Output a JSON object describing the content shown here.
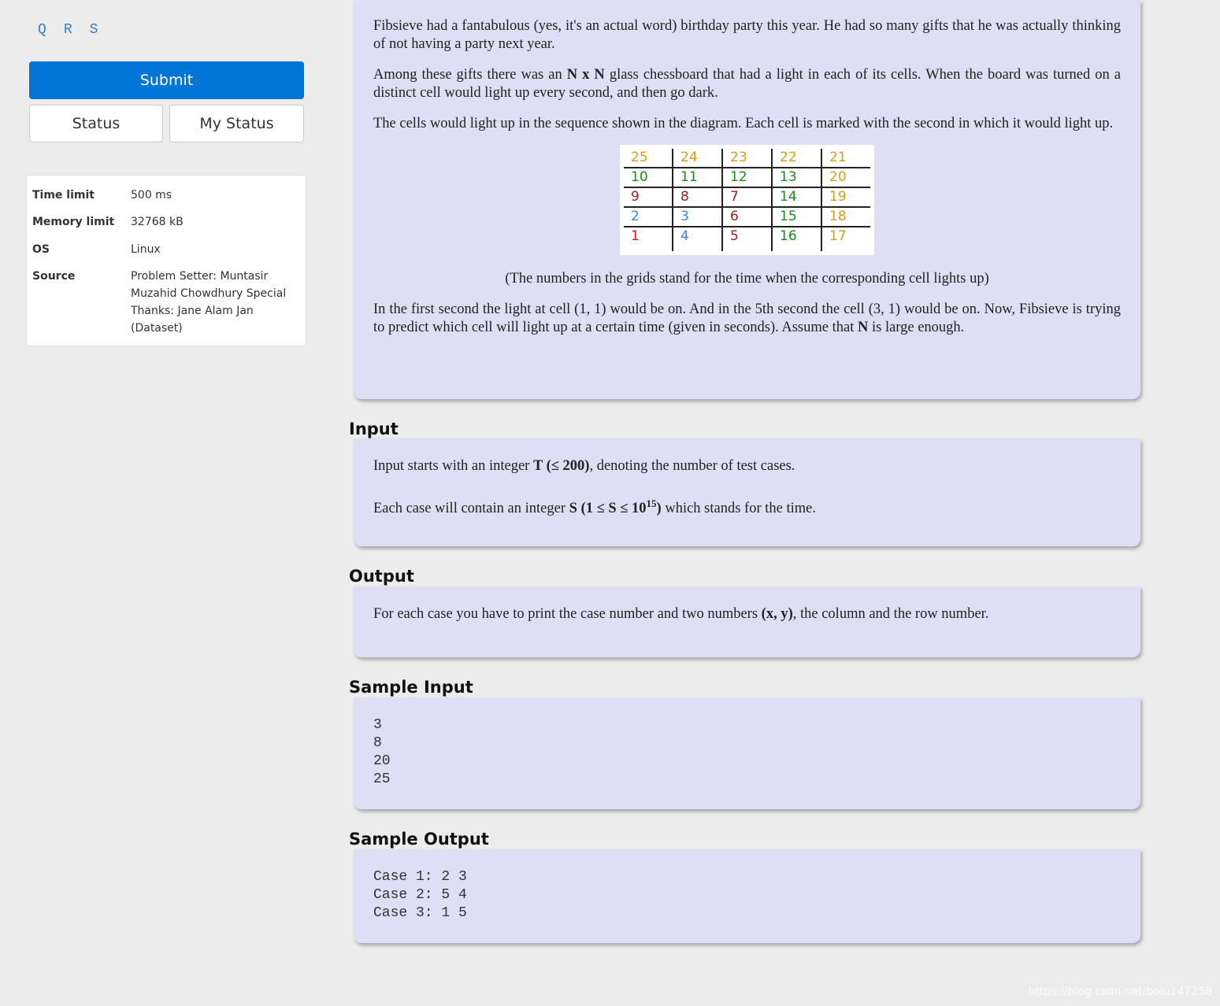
{
  "nav": {
    "letters": [
      "Q",
      "R",
      "S"
    ]
  },
  "buttons": {
    "submit": "Submit",
    "status": "Status",
    "my_status": "My Status"
  },
  "info": [
    {
      "k": "Time limit",
      "v": "500 ms"
    },
    {
      "k": "Memory limit",
      "v": "32768 kB"
    },
    {
      "k": "OS",
      "v": "Linux"
    },
    {
      "k": "Source",
      "v": "Problem Setter: Muntasir Muzahid Chowdhury Special Thanks: Jane Alam Jan (Dataset)"
    }
  ],
  "statement": {
    "p1": "Fibsieve had a fantabulous (yes, it's an actual word) birthday party this year. He had so many gifts that he was actually thinking of not having a party next year.",
    "p2a": "Among these gifts there was an ",
    "p2b": "N x N",
    "p2c": " glass chessboard that had a light in each of its cells. When the board was turned on a distinct cell would light up every second, and then go dark.",
    "p3": "The cells would light up in the sequence shown in the diagram. Each cell is marked with the second in which it would light up.",
    "grid": [
      [
        "25",
        "24",
        "23",
        "22",
        "21"
      ],
      [
        "10",
        "11",
        "12",
        "13",
        "20"
      ],
      [
        "9",
        "8",
        "7",
        "14",
        "19"
      ],
      [
        "2",
        "3",
        "6",
        "15",
        "18"
      ],
      [
        "1",
        "4",
        "5",
        "16",
        "17"
      ]
    ],
    "grid_colors": [
      [
        "#d4a017",
        "#d4a017",
        "#d4a017",
        "#d4a017",
        "#d4a017"
      ],
      [
        "#1a8a1a",
        "#1a8a1a",
        "#1a8a1a",
        "#1a8a1a",
        "#d4a017"
      ],
      [
        "#992222",
        "#992222",
        "#992222",
        "#1a8a1a",
        "#d4a017"
      ],
      [
        "#3388ee",
        "#3388ee",
        "#992222",
        "#1a8a1a",
        "#d4a017"
      ],
      [
        "#ee1111",
        "#3388ee",
        "#992222",
        "#1a8a1a",
        "#d4a017"
      ]
    ],
    "caption": "(The numbers in the grids stand for the time when the corresponding cell lights up)",
    "p4a": "In the first second the light at cell (1, 1) would be on. And in the 5th second the cell (3, 1) would be on. Now, Fibsieve is trying to predict which cell will light up at a certain time (given in seconds). Assume that ",
    "p4b": "N",
    "p4c": " is large enough."
  },
  "input": {
    "title": "Input",
    "a1": "Input starts with an integer ",
    "b1": "T (≤ 200)",
    "c1": ", denoting the number of test cases.",
    "a2": "Each case will contain an integer ",
    "b2": "S (1 ≤ S ≤ 10",
    "sup": "15",
    "b2e": ")",
    "c2": " which stands for the time."
  },
  "output": {
    "title": "Output",
    "a": "For each case you have to print the case number and two numbers ",
    "b": "(x, y)",
    "c": ", the column and the row number."
  },
  "sample_input": {
    "title": "Sample Input",
    "text": "3\n8\n20\n25"
  },
  "sample_output": {
    "title": "Sample Output",
    "text": "Case 1: 2 3\nCase 2: 5 4\nCase 3: 1 5"
  },
  "watermark": "https://blog.csdn.net/bolu147258"
}
